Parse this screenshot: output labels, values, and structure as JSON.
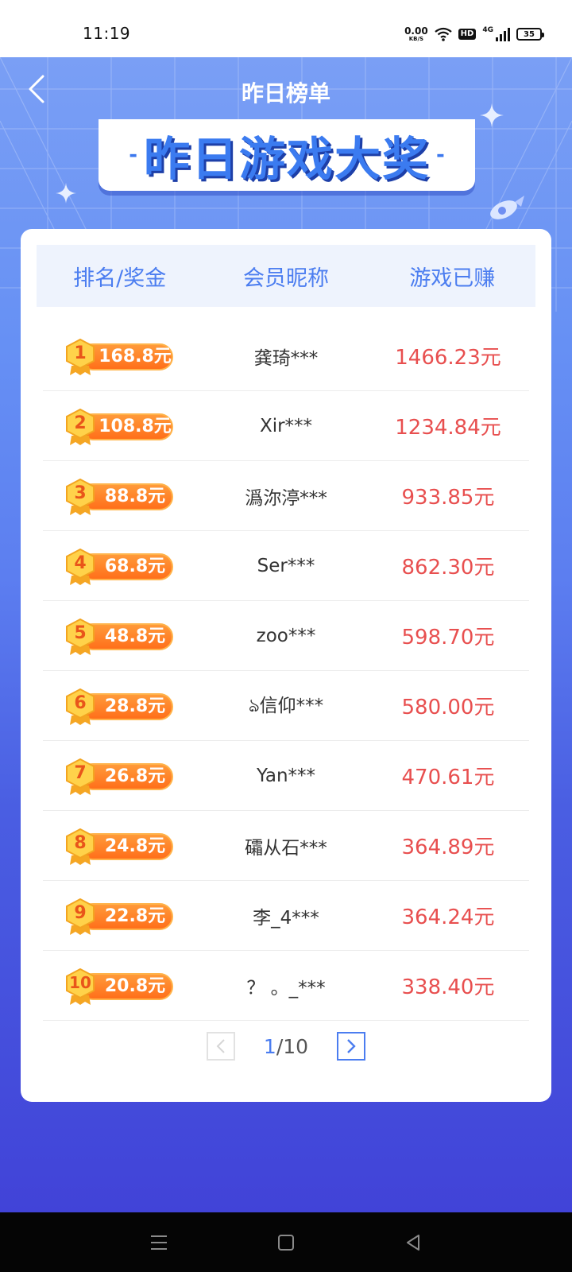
{
  "status_bar": {
    "time": "11:19",
    "net_speed_value": "0.00",
    "net_speed_unit": "KB/S",
    "hd_label": "HD",
    "signal_label": "4G",
    "battery": "35"
  },
  "nav": {
    "title": "昨日榜单",
    "banner_title": "昨日游戏大奖",
    "banner_dash": "-"
  },
  "table": {
    "headers": [
      "排名/奖金",
      "会员昵称",
      "游戏已赚"
    ],
    "rows": [
      {
        "rank": "1",
        "prize": "168.8元",
        "name": "龚琦***",
        "earned": "1466.23元"
      },
      {
        "rank": "2",
        "prize": "108.8元",
        "name": "Xir***",
        "earned": "1234.84元"
      },
      {
        "rank": "3",
        "prize": "88.8元",
        "name": "潙沵渟***",
        "earned": "933.85元"
      },
      {
        "rank": "4",
        "prize": "68.8元",
        "name": "Ser***",
        "earned": "862.30元"
      },
      {
        "rank": "5",
        "prize": "48.8元",
        "name": "zoo***",
        "earned": "598.70元"
      },
      {
        "rank": "6",
        "prize": "28.8元",
        "name": "ঌ信仰***",
        "earned": "580.00元"
      },
      {
        "rank": "7",
        "prize": "26.8元",
        "name": "Yan***",
        "earned": "470.61元"
      },
      {
        "rank": "8",
        "prize": "24.8元",
        "name": "礵从石***",
        "earned": "364.89元"
      },
      {
        "rank": "9",
        "prize": "22.8元",
        "name": "李_4***",
        "earned": "364.24元"
      },
      {
        "rank": "10",
        "prize": "20.8元",
        "name": "？ 。_***",
        "earned": "338.40元"
      }
    ]
  },
  "pager": {
    "current": "1",
    "separator": "/",
    "total": "10"
  },
  "colors": {
    "accent": "#4b7df0",
    "amount": "#e84f4f",
    "prize_pill": "#ff7a22",
    "background_top": "#7a9ff5",
    "background_bottom": "#4143d8"
  },
  "icons": {
    "back": "chevron-left-icon",
    "pager_prev": "chevron-left-icon",
    "pager_next": "chevron-right-icon",
    "sys_menu": "menu-icon",
    "sys_home": "square-icon",
    "sys_back": "triangle-back-icon"
  }
}
